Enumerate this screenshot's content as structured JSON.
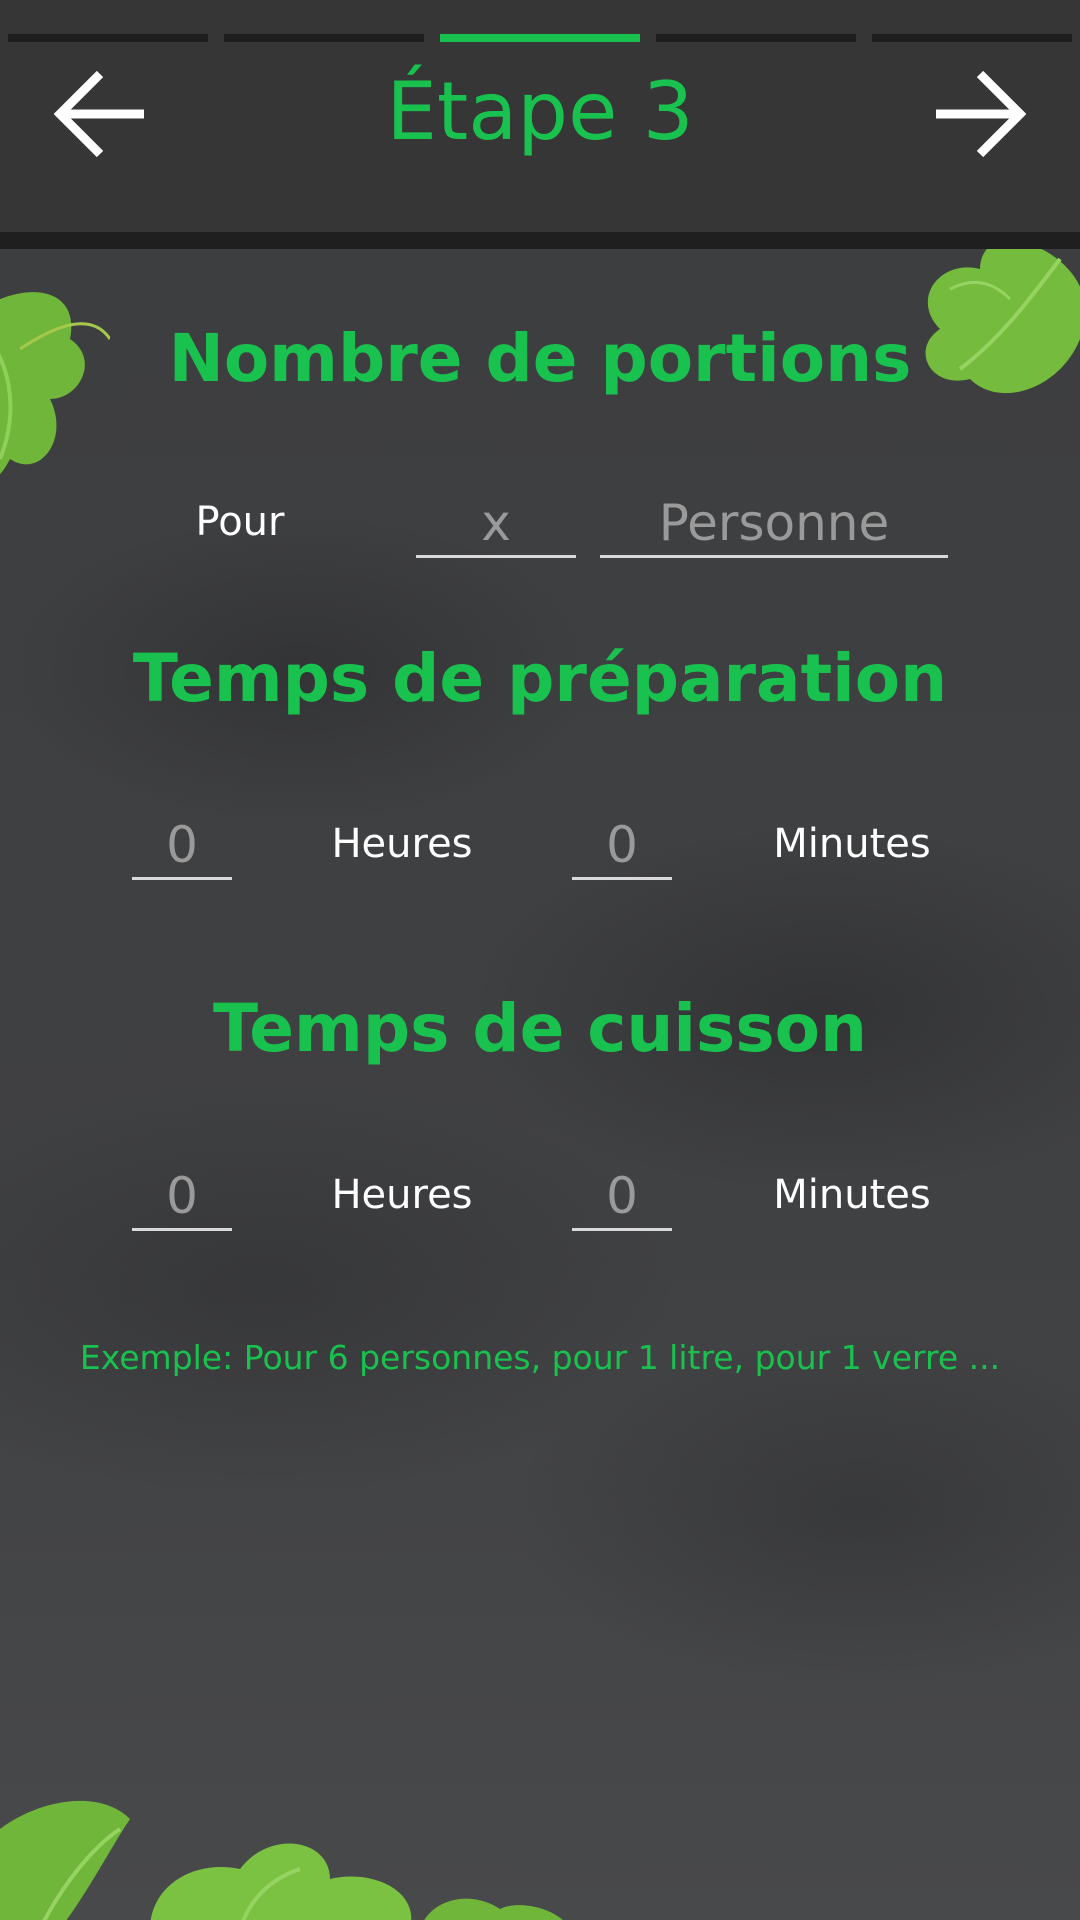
{
  "header": {
    "title": "Étape 3",
    "step_count": 5,
    "active_step": 3,
    "back_icon": "arrow-left-icon",
    "next_icon": "arrow-right-icon"
  },
  "portions": {
    "title": "Nombre de portions",
    "prefix_label": "Pour",
    "quantity_placeholder": "x",
    "unit_placeholder": "Personne"
  },
  "preparation": {
    "title": "Temps de préparation",
    "hours_value": "0",
    "hours_label": "Heures",
    "minutes_value": "0",
    "minutes_label": "Minutes"
  },
  "cooking": {
    "title": "Temps de cuisson",
    "hours_value": "0",
    "hours_label": "Heures",
    "minutes_value": "0",
    "minutes_label": "Minutes"
  },
  "hint": "Exemple: Pour 6 personnes, pour 1 litre, pour 1 verre ...",
  "colors": {
    "accent": "#19c24e",
    "topbar": "#363636",
    "background": "#3d3e40",
    "leaf": "#7cc242"
  }
}
